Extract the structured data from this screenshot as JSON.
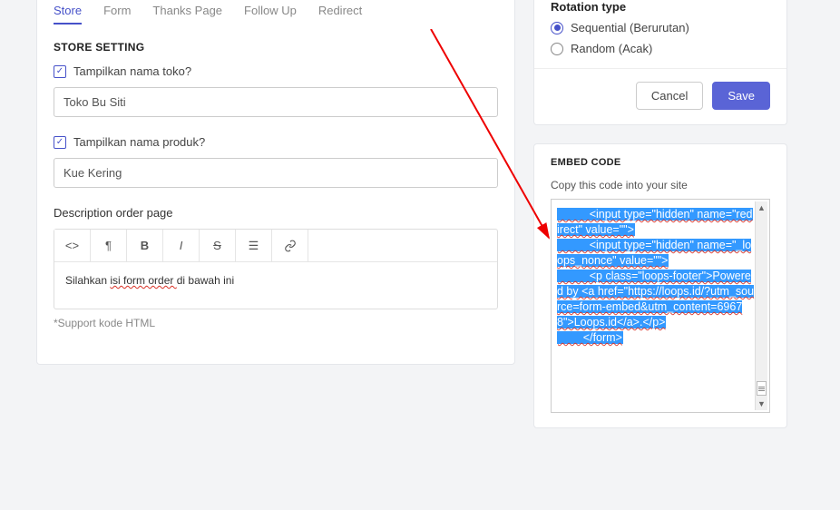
{
  "tabs": [
    "Store",
    "Form",
    "Thanks Page",
    "Follow Up",
    "Redirect"
  ],
  "sectionTitle": "STORE SETTING",
  "storeCheck": "Tampilkan nama toko?",
  "storeValue": "Toko Bu Siti",
  "productCheck": "Tampilkan nama produk?",
  "productValue": "Kue Kering",
  "descLabel": "Description order page",
  "editorText1": "Silahkan ",
  "editorText2": "isi form ",
  "editorText3": "order ",
  "editorText4": "di bawah ini",
  "hintText": "*Support kode HTML",
  "rotationLabel": "Rotation type",
  "radio1": "Sequential (Berurutan)",
  "radio2": "Random (Acak)",
  "cancelLabel": "Cancel",
  "saveLabel": "Save",
  "embedTitle": "EMBED CODE",
  "embedCaption": "Copy this code into your site",
  "code": {
    "l1": "          <input type=\"hidden\" name=\"redirect\" value=\"\">",
    "l2": "          <input type=\"hidden\" name=\"_loops_nonce\" value=\"\">",
    "l3": "          <p class=\"loops-footer\">Powered by <a href=\"https://loops.id/?utm_source=form-embed&utm_content=69678\">Loops.id</a>.</p>",
    "l4": "        </form>"
  }
}
